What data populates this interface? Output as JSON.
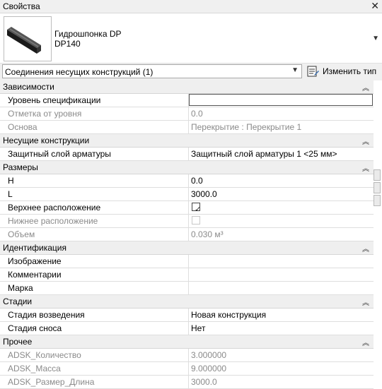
{
  "window": {
    "title": "Свойства",
    "close_glyph": "✕"
  },
  "type_selector": {
    "family": "Гидрошпонка DP",
    "type": "DP140"
  },
  "filter": {
    "selected": "Соединения несущих конструкций (1)"
  },
  "edit_type": {
    "label": "Изменить тип"
  },
  "groups": [
    {
      "name": "Зависимости",
      "rows": [
        {
          "name": "Уровень спецификации",
          "value": "",
          "readonly": false,
          "editing": true
        },
        {
          "name": "Отметка от уровня",
          "value": "0.0",
          "readonly": true
        },
        {
          "name": "Основа",
          "value": "Перекрытие : Перекрытие 1",
          "readonly": true
        }
      ]
    },
    {
      "name": "Несущие конструкции",
      "rows": [
        {
          "name": "Защитный слой арматуры",
          "value": "Защитный слой арматуры 1 <25 мм>",
          "readonly": false
        }
      ]
    },
    {
      "name": "Размеры",
      "rows": [
        {
          "name": "H",
          "value": "0.0",
          "readonly": false
        },
        {
          "name": "L",
          "value": "3000.0",
          "readonly": false
        },
        {
          "name": "Верхнее расположение",
          "checkbox": true,
          "checked": true,
          "readonly": false
        },
        {
          "name": "Нижнее расположение",
          "checkbox": true,
          "checked": false,
          "readonly": true
        },
        {
          "name": "Объем",
          "value": "0.030 м³",
          "readonly": true
        }
      ]
    },
    {
      "name": "Идентификация",
      "rows": [
        {
          "name": "Изображение",
          "value": "",
          "readonly": false
        },
        {
          "name": "Комментарии",
          "value": "",
          "readonly": false
        },
        {
          "name": "Марка",
          "value": "",
          "readonly": false
        }
      ]
    },
    {
      "name": "Стадии",
      "rows": [
        {
          "name": "Стадия возведения",
          "value": "Новая конструкция",
          "readonly": false
        },
        {
          "name": "Стадия сноса",
          "value": "Нет",
          "readonly": false
        }
      ]
    },
    {
      "name": "Прочее",
      "rows": [
        {
          "name": "ADSK_Количество",
          "value": "3.000000",
          "readonly": true
        },
        {
          "name": "ADSK_Масса",
          "value": "9.000000",
          "readonly": true
        },
        {
          "name": "ADSK_Размер_Длина",
          "value": "3000.0",
          "readonly": true
        }
      ]
    }
  ],
  "icons": {
    "close": "close-icon",
    "dropdown": "chevron-down-icon",
    "edit_type": "edit-type-icon",
    "collapse": "collapse-chevron-icon",
    "checkbox_tick": "checkmark-icon"
  }
}
